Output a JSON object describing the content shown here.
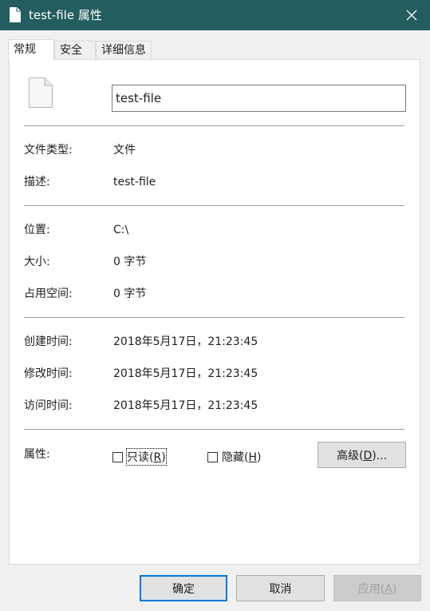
{
  "window": {
    "title": "test-file 属性",
    "title_bar_color": "#235d5f",
    "icons": {
      "title": "file-icon",
      "close": "close-icon"
    }
  },
  "tabs": [
    {
      "label": "常规",
      "active": true
    },
    {
      "label": "安全",
      "active": false
    },
    {
      "label": "详细信息",
      "active": false
    }
  ],
  "general": {
    "file_name": "test-file",
    "file_type_label": "文件类型:",
    "file_type_value": "文件",
    "description_label": "描述:",
    "description_value": "test-file",
    "location_label": "位置:",
    "location_value": "C:\\",
    "size_label": "大小:",
    "size_value": "0 字节",
    "size_on_disk_label": "占用空间:",
    "size_on_disk_value": "0 字节",
    "created_label": "创建时间:",
    "created_value": "2018年5月17日，21:23:45",
    "modified_label": "修改时间:",
    "modified_value": "2018年5月17日，21:23:45",
    "accessed_label": "访问时间:",
    "accessed_value": "2018年5月17日，21:23:45",
    "attributes_label": "属性:",
    "readonly": {
      "text": "只读(",
      "key": "R",
      "tail": ")",
      "checked": false
    },
    "hidden": {
      "text": "隐藏(",
      "key": "H",
      "tail": ")",
      "checked": false
    },
    "advanced": {
      "text": "高级(",
      "key": "D",
      "tail": ")..."
    }
  },
  "footer": {
    "ok_label": "确定",
    "cancel_label": "取消",
    "apply": {
      "text": "应用(",
      "key": "A",
      "tail": ")",
      "disabled": true
    },
    "accent_color": "#0078d7"
  }
}
